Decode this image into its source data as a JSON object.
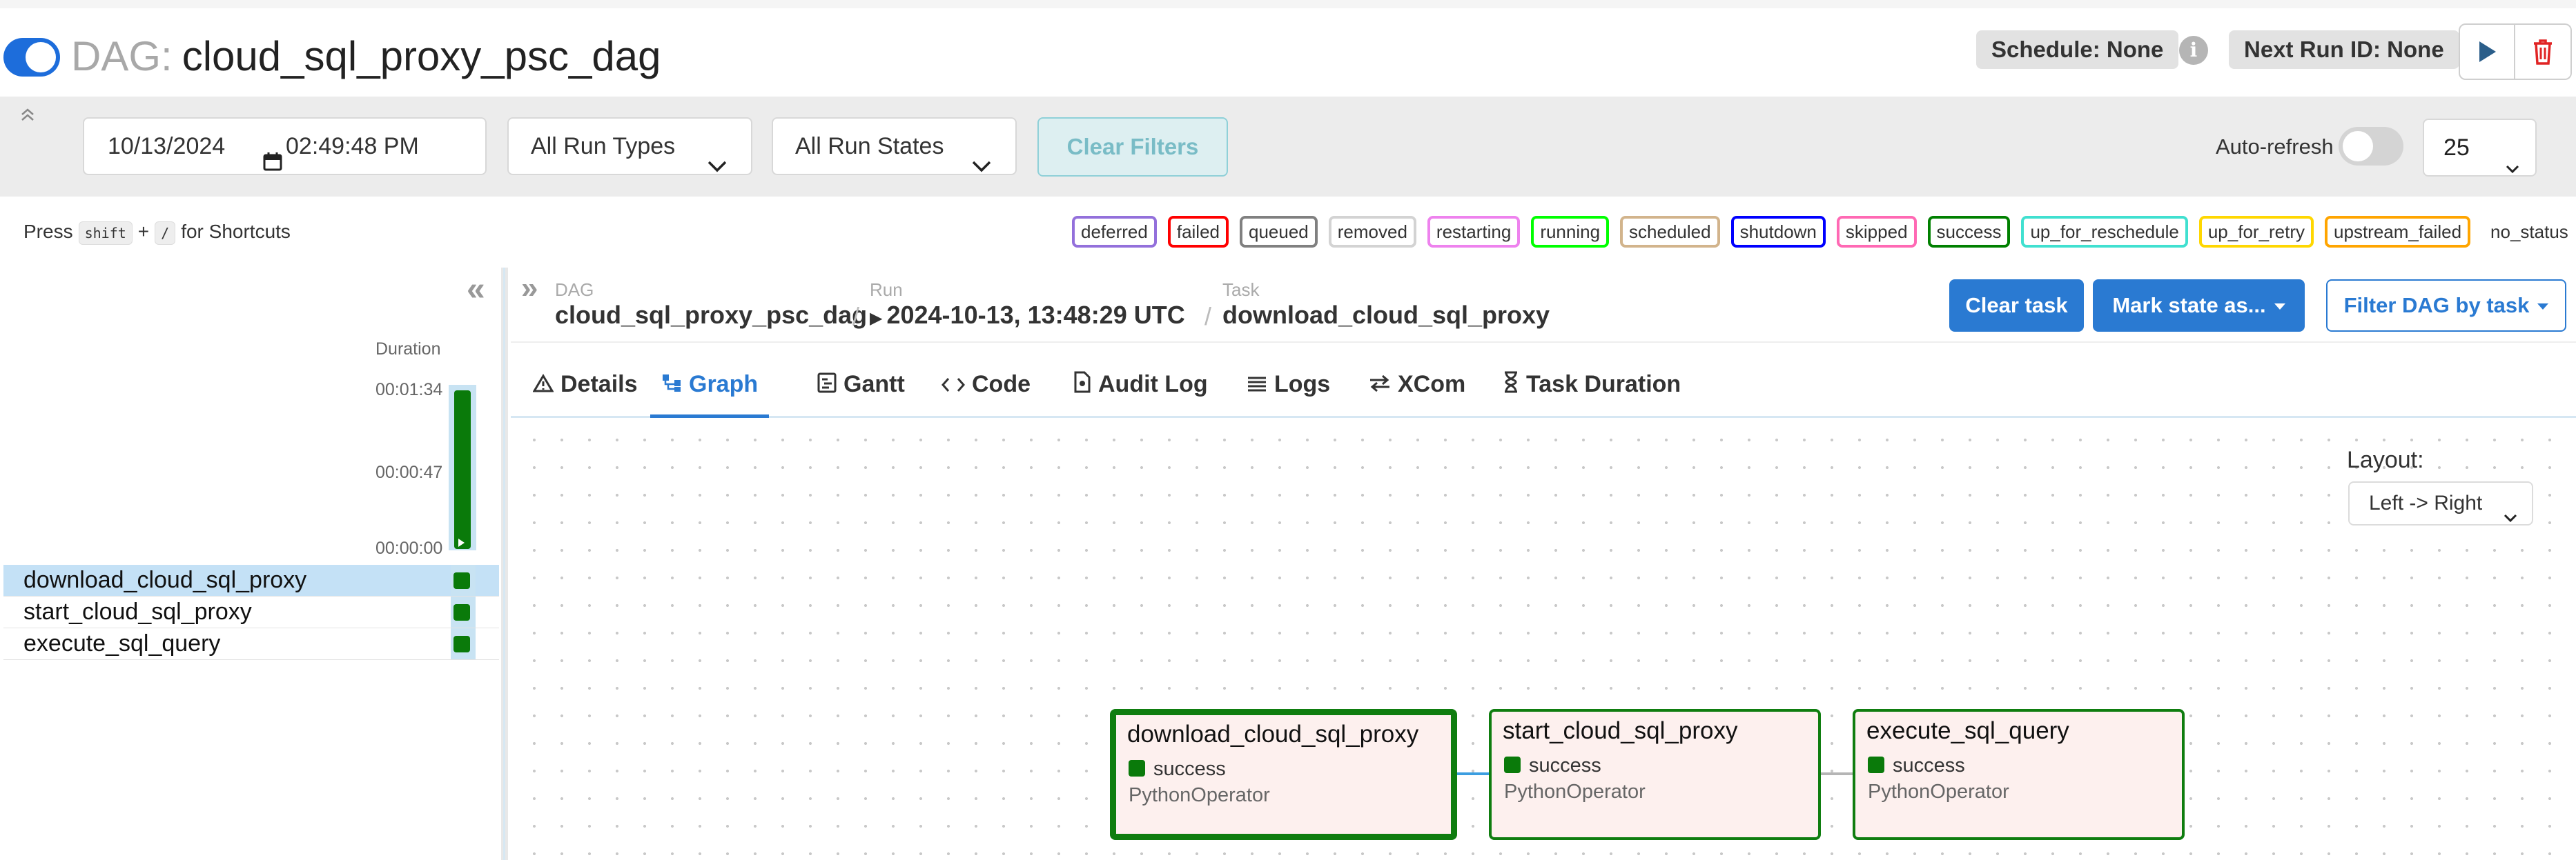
{
  "header": {
    "dag_prefix": "DAG:",
    "dag_name": "cloud_sql_proxy_psc_dag",
    "schedule": "Schedule: None",
    "next_run": "Next Run ID: None"
  },
  "filters": {
    "date": "10/13/2024",
    "time": "02:49:48 PM",
    "run_types": "All Run Types",
    "run_states": "All Run States",
    "clear_filters": "Clear Filters",
    "auto_refresh_label": "Auto-refresh",
    "page_size": "25"
  },
  "shortcuts": {
    "press": "Press",
    "key1": "shift",
    "plus": "+",
    "key2": "/",
    "suffix": "for Shortcuts"
  },
  "legend": [
    {
      "label": "deferred",
      "color": "#9370db"
    },
    {
      "label": "failed",
      "color": "#ff0000"
    },
    {
      "label": "queued",
      "color": "#808080"
    },
    {
      "label": "removed",
      "color": "#d3d3d3"
    },
    {
      "label": "restarting",
      "color": "#ee82ee"
    },
    {
      "label": "running",
      "color": "#00ff00"
    },
    {
      "label": "scheduled",
      "color": "#d2b48c"
    },
    {
      "label": "shutdown",
      "color": "#0000ff"
    },
    {
      "label": "skipped",
      "color": "#ff69b4"
    },
    {
      "label": "success",
      "color": "#008000"
    },
    {
      "label": "up_for_reschedule",
      "color": "#40e0d0"
    },
    {
      "label": "up_for_retry",
      "color": "#ffd700"
    },
    {
      "label": "upstream_failed",
      "color": "#ffa500"
    },
    {
      "label": "no_status",
      "color": "transparent"
    }
  ],
  "grid": {
    "duration_label": "Duration",
    "ticks": [
      "00:01:34",
      "00:00:47",
      "00:00:00"
    ],
    "tasks": [
      {
        "name": "download_cloud_sql_proxy",
        "selected": true
      },
      {
        "name": "start_cloud_sql_proxy",
        "selected": false
      },
      {
        "name": "execute_sql_query",
        "selected": false
      }
    ]
  },
  "breadcrumb": {
    "dag_label": "DAG",
    "dag_value": "cloud_sql_proxy_psc_dag",
    "run_label": "Run",
    "run_value": "2024-10-13, 13:48:29 UTC",
    "task_label": "Task",
    "task_value": "download_cloud_sql_proxy"
  },
  "actions": {
    "clear_task": "Clear task",
    "mark_state": "Mark state as...",
    "filter_dag": "Filter DAG by task"
  },
  "tabs": [
    {
      "label": "Details",
      "icon": "warning-icon"
    },
    {
      "label": "Graph",
      "icon": "graph-icon",
      "active": true
    },
    {
      "label": "Gantt",
      "icon": "gantt-icon"
    },
    {
      "label": "Code",
      "icon": "code-icon"
    },
    {
      "label": "Audit Log",
      "icon": "file-icon"
    },
    {
      "label": "Logs",
      "icon": "list-icon"
    },
    {
      "label": "XCom",
      "icon": "swap-icon"
    },
    {
      "label": "Task Duration",
      "icon": "hourglass-icon"
    }
  ],
  "graph": {
    "layout_label": "Layout:",
    "layout_value": "Left -> Right",
    "nodes": [
      {
        "name": "download_cloud_sql_proxy",
        "state": "success",
        "operator": "PythonOperator"
      },
      {
        "name": "start_cloud_sql_proxy",
        "state": "success",
        "operator": "PythonOperator"
      },
      {
        "name": "execute_sql_query",
        "state": "success",
        "operator": "PythonOperator"
      }
    ]
  },
  "colors": {
    "primary": "#2a7ad2",
    "success": "#008000",
    "selected_row": "#c4e1f6",
    "node_fill": "#fdf0ee"
  }
}
